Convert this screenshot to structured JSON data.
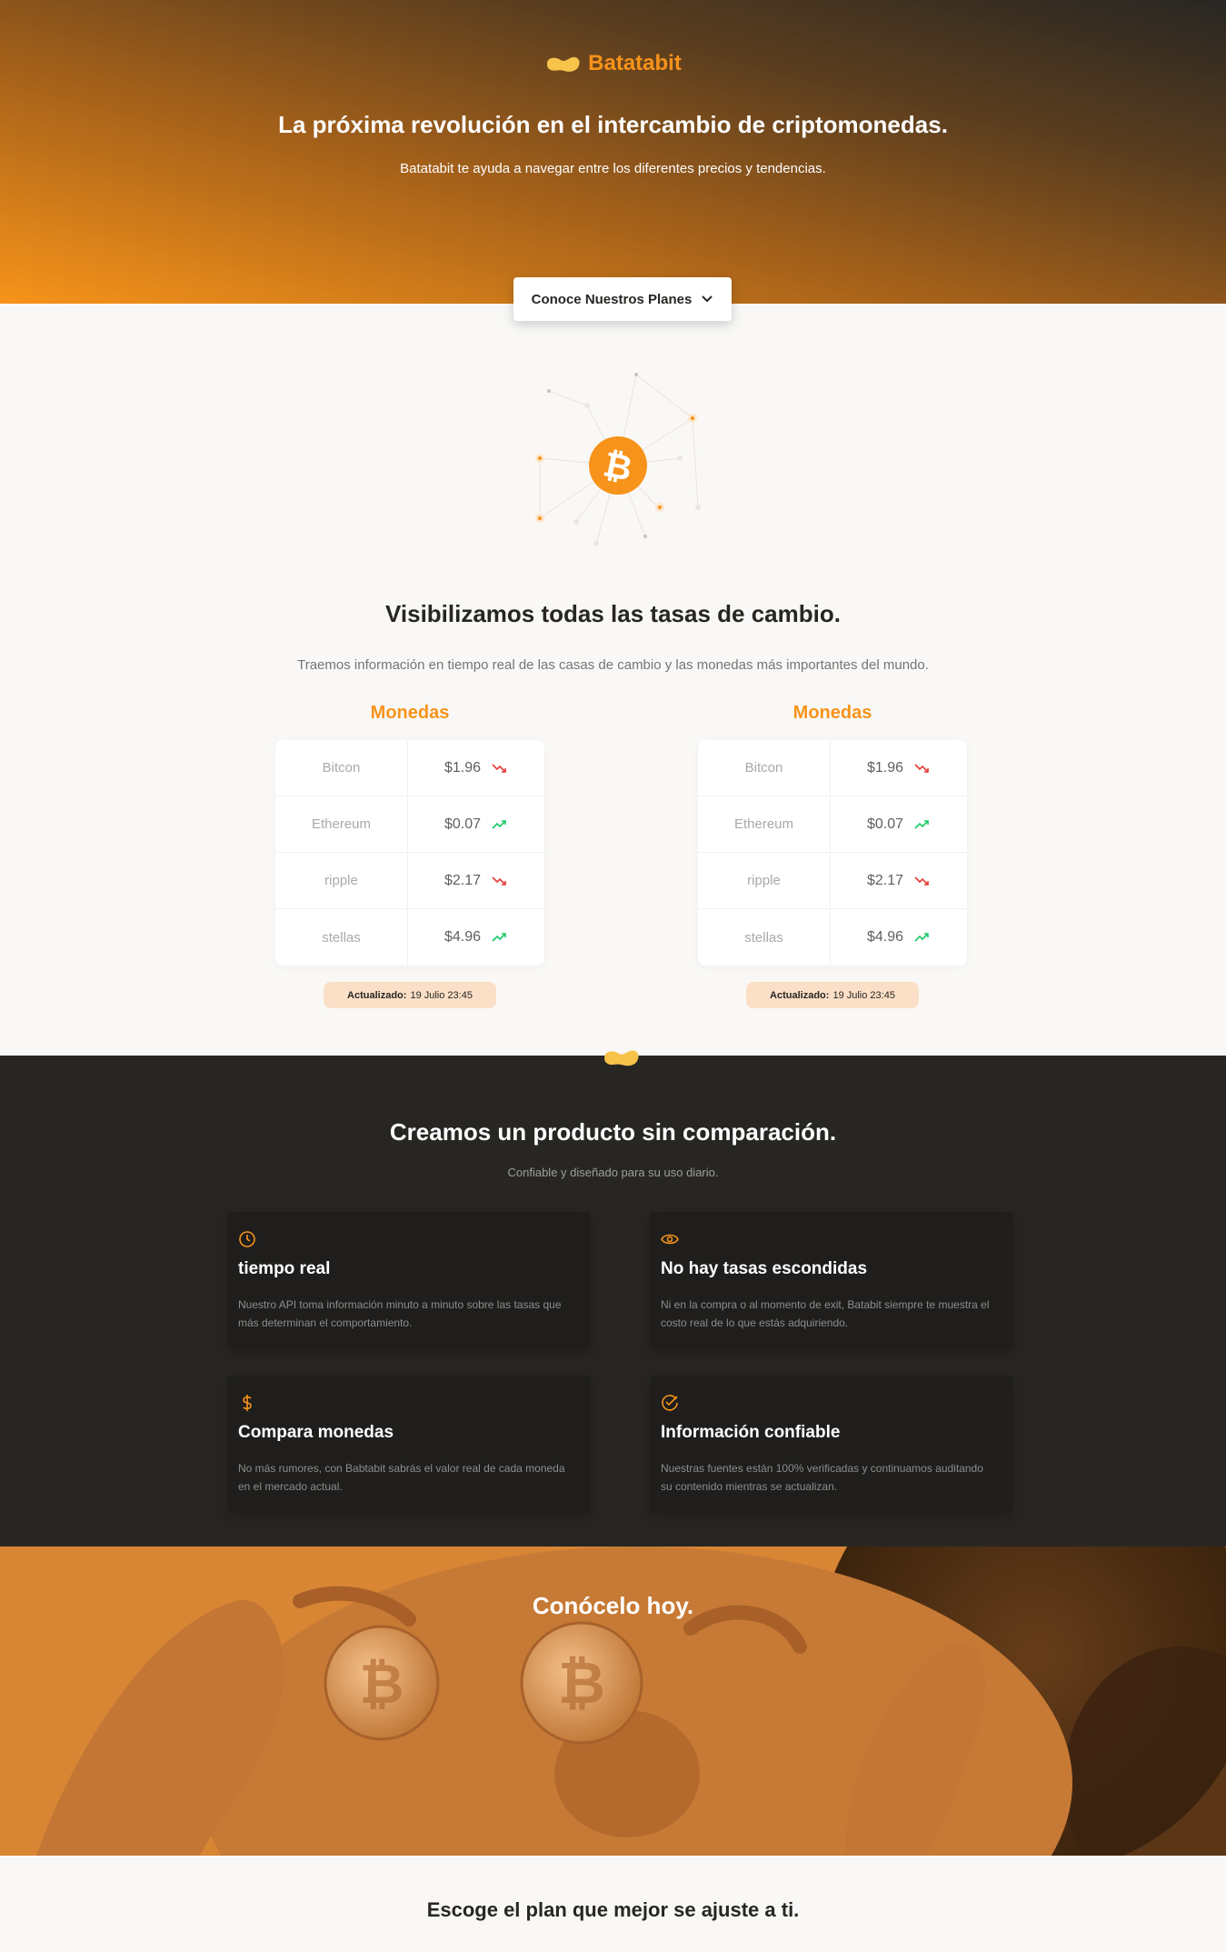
{
  "hero": {
    "brand": "Batatabit",
    "title": "La próxima revolución en el intercambio de criptomonedas.",
    "subtitle": "Batatabit te ayuda a navegar entre los diferentes precios y tendencias.",
    "plans_button": "Conoce Nuestros Planes"
  },
  "rates": {
    "title": "Visibilizamos todas las tasas de cambio.",
    "subtitle": "Traemos información en tiempo real de las casas de cambio y las monedas más importantes del mundo.",
    "tables": [
      {
        "caption": "Monedas",
        "rows": [
          {
            "name": "Bitcon",
            "price": "$1.96",
            "trend": "down"
          },
          {
            "name": "Ethereum",
            "price": "$0.07",
            "trend": "up"
          },
          {
            "name": "ripple",
            "price": "$2.17",
            "trend": "down"
          },
          {
            "name": "stellas",
            "price": "$4.96",
            "trend": "up"
          }
        ],
        "updated_label": "Actualizado:",
        "updated_value": "19 Julio 23:45"
      },
      {
        "caption": "Monedas",
        "rows": [
          {
            "name": "Bitcon",
            "price": "$1.96",
            "trend": "down"
          },
          {
            "name": "Ethereum",
            "price": "$0.07",
            "trend": "up"
          },
          {
            "name": "ripple",
            "price": "$2.17",
            "trend": "down"
          },
          {
            "name": "stellas",
            "price": "$4.96",
            "trend": "up"
          }
        ],
        "updated_label": "Actualizado:",
        "updated_value": "19 Julio 23:45"
      }
    ]
  },
  "product": {
    "title": "Creamos un producto sin comparación.",
    "subtitle": "Confiable y diseñado para su uso diario.",
    "features": [
      {
        "icon": "clock-icon",
        "title": "tiempo real",
        "text": "Nuestro API toma información minuto a minuto sobre las tasas que más determinan el comportamiento."
      },
      {
        "icon": "eye-icon",
        "title": "No hay tasas escondidas",
        "text": "Ni en la compra o al momento de exit, Batabit siempre te muestra el costo real de lo que estás adquiriendo."
      },
      {
        "icon": "dollar-icon",
        "title": "Compara monedas",
        "text": "No más rumores, con Babtabit sabrás el valor real de cada moneda en el mercado actual."
      },
      {
        "icon": "check-circle-icon",
        "title": "Información confiable",
        "text": "Nuestras fuentes están 100% verificadas y continuamos auditando su contenido mientras se actualizan."
      }
    ]
  },
  "cta": {
    "title": "Conócelo hoy."
  },
  "plans": {
    "title": "Escoge el plan que mejor se ajuste a ti."
  },
  "colors": {
    "accent": "#f7931a",
    "dark": "#282623",
    "trend_up": "#18c964",
    "trend_down": "#e53935"
  }
}
